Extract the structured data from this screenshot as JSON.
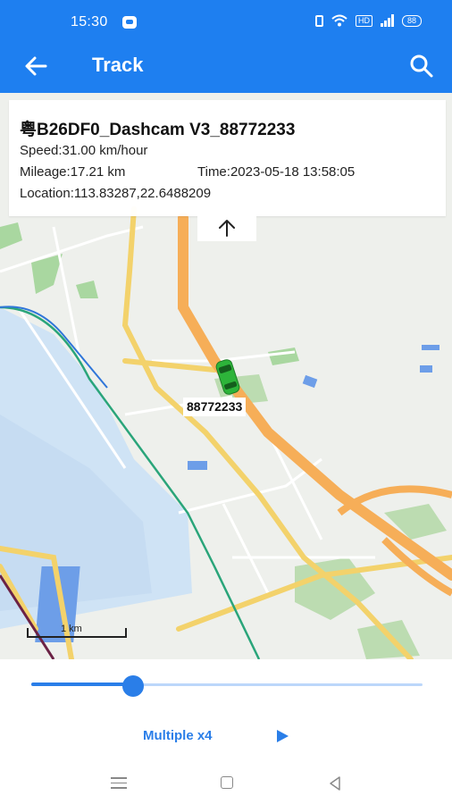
{
  "status_bar": {
    "time": "15:30",
    "network_badge": "HD",
    "battery": "88"
  },
  "app_bar": {
    "title": "Track",
    "back_icon": "arrow-left-icon",
    "search_icon": "search-icon"
  },
  "vehicle_info": {
    "title": "粤B26DF0_Dashcam V3_88772233",
    "speed": "Speed:31.00 km/hour",
    "mileage": "Mileage:17.21 km",
    "time": "Time:2023-05-18 13:58:05",
    "location": "Location:113.83287,22.6488209",
    "collapse_icon": "arrow-up-icon"
  },
  "map": {
    "vehicle_label": "88772233",
    "scale_label": "1 km",
    "vehicle_color": "#2db43a"
  },
  "playback": {
    "progress_fraction": 0.26,
    "speed_label": "Multiple x4",
    "play_icon": "play-icon",
    "accent_color": "#2a7ee8"
  },
  "nav_bar": {
    "menu_icon": "menu-icon",
    "home_icon": "home-icon",
    "back_icon": "triangle-back-icon"
  }
}
